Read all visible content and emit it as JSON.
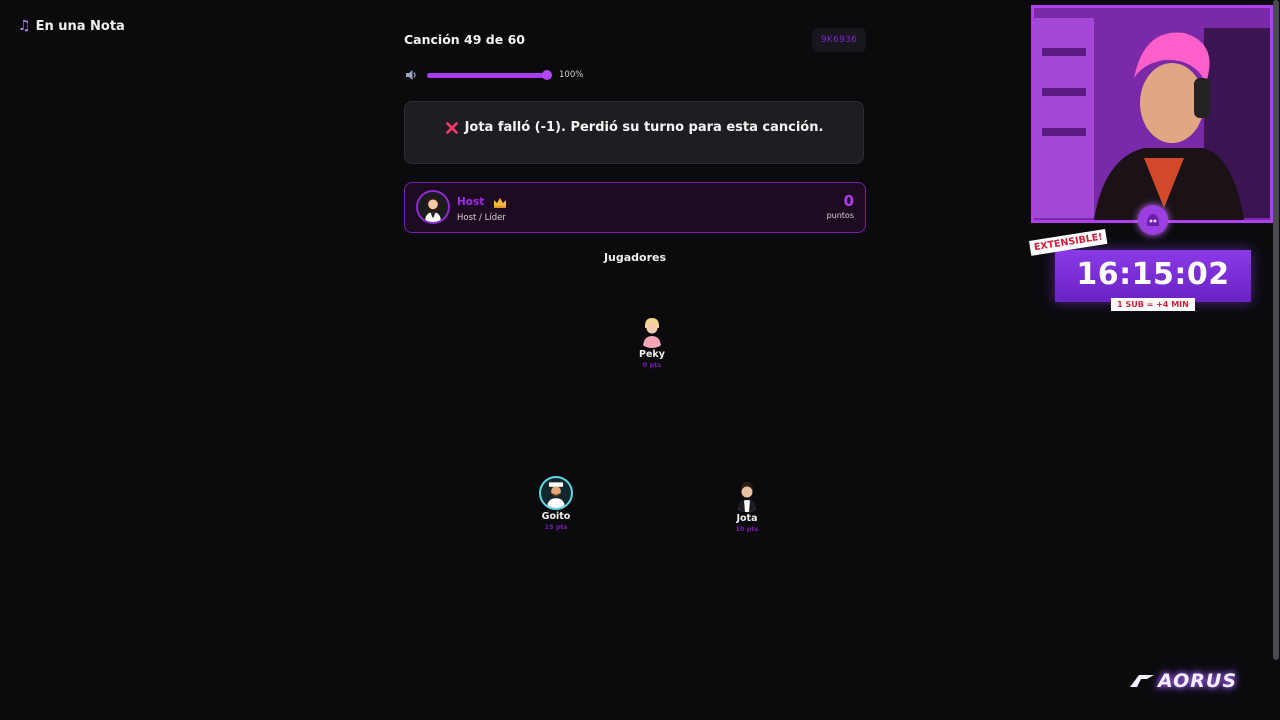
{
  "app": {
    "title": "En una Nota",
    "title_icon": "music-note-icon"
  },
  "header": {
    "song_counter": "Canción 49 de 60",
    "room_code": "9K6936"
  },
  "volume": {
    "level": 1.0,
    "label": "100%"
  },
  "message": {
    "icon": "x-icon",
    "text": "Jota falló (-1). Perdió su turno para esta canción.",
    "icon_color": "#ff3b6b"
  },
  "host": {
    "name": "Host",
    "role": "Host / Líder",
    "points": "0",
    "points_label": "puntos",
    "badge_icon": "crown-icon"
  },
  "players_section": {
    "title": "Jugadores",
    "players": [
      {
        "name": "Peky",
        "points": "0 pts"
      },
      {
        "name": "Goito",
        "points": "15 pts"
      },
      {
        "name": "Jota",
        "points": "10 pts"
      }
    ]
  },
  "stream_overlay": {
    "timer": "16:15:02",
    "extensible_label": "EXTENSIBLE!",
    "sub_label": "1 SUB = +4 MIN",
    "brand": "AORUS"
  },
  "colors": {
    "accent": "#a63cf2",
    "background": "#0b0b0e",
    "panel": "#1e1e22",
    "host_border": "#7a1cae",
    "active_ring": "#5fd6e6"
  }
}
